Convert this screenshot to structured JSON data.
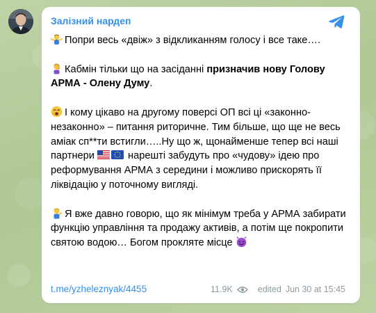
{
  "channel": {
    "name": "Залізний нардеп",
    "avatar_icon": "avatar-photo",
    "share_icon": "telegram-plane-icon",
    "accent_color": "#3390ec"
  },
  "message": {
    "p1": {
      "emoji": "person-shrugging-emoji",
      "text": "Попри весь «двіж» з відкликанням голосу і все таке…."
    },
    "p2": {
      "emoji": "person-facepalm-emoji",
      "text_before": "Кабмін тільки що на засіданні ",
      "bold": "призначив нову Голову АРМА - Олену Думу",
      "text_after": "."
    },
    "p3": {
      "emoji": "yawning-face-emoji",
      "text_before": "І кому цікаво на другому поверсі ОП всі ці «законно-незаконно» – питання риторичне. Тим більше, що ще не весь аміак сп**ти встигли…..Ну що ж, щонайменше тепер всі наші партнери ",
      "flags": [
        "us-flag-emoji",
        "eu-flag-emoji"
      ],
      "text_after": " нарешті забудуть про «чудову» ідею про реформування АРМА з середини і можливо прискорять її ліквідацію у поточному вигляді."
    },
    "p4": {
      "emoji": "person-tipping-hand-emoji",
      "text": "Я вже давно говорю, що як мінімум треба у АРМА забирати функцію управління та продажу активів, а потім ще покропити святою водою… Богом прокляте місце ",
      "end_emoji": "smiling-devil-emoji"
    }
  },
  "footer": {
    "link": "t.me/yzheleznyak/4455",
    "views": "11.9K",
    "views_icon": "eye-icon",
    "edited": "edited",
    "date": "Jun 30 at 15:45"
  }
}
